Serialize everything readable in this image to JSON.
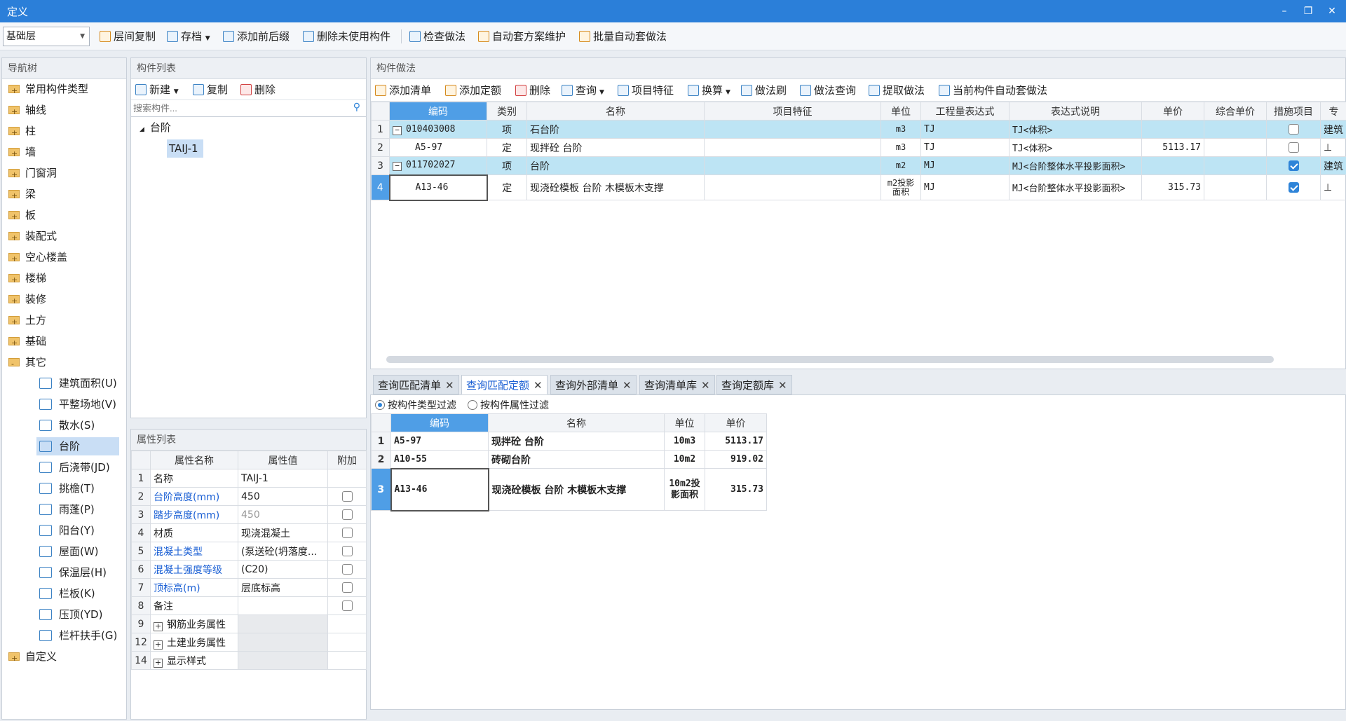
{
  "window": {
    "title": "定义",
    "minimize": "–",
    "restore": "❐",
    "close": "✕"
  },
  "toolbar": {
    "floor_select": "基础层",
    "items": [
      "层间复制",
      "存档",
      "添加前后缀",
      "删除未使用构件",
      "检查做法",
      "自动套方案维护",
      "批量自动套做法"
    ]
  },
  "nav": {
    "header": "导航树",
    "top_items": [
      "常用构件类型",
      "轴线",
      "柱",
      "墙",
      "门窗洞",
      "梁",
      "板",
      "装配式",
      "空心楼盖",
      "楼梯",
      "装修",
      "土方",
      "基础",
      "其它"
    ],
    "sub_items": [
      "建筑面积(U)",
      "平整场地(V)",
      "散水(S)",
      "台阶",
      "后浇带(JD)",
      "挑檐(T)",
      "雨蓬(P)",
      "阳台(Y)",
      "屋面(W)",
      "保温层(H)",
      "栏板(K)",
      "压顶(YD)",
      "栏杆扶手(G)"
    ],
    "last_item": "自定义"
  },
  "component_list": {
    "header": "构件列表",
    "new_label": "新建",
    "copy_label": "复制",
    "delete_label": "删除",
    "search_placeholder": "搜索构件...",
    "group": "台阶",
    "item": "TAIJ-1"
  },
  "properties": {
    "header": "属性列表",
    "columns": [
      "属性名称",
      "属性值",
      "附加"
    ],
    "rows": [
      {
        "n": "1",
        "name": "名称",
        "value": "TAIJ-1"
      },
      {
        "n": "2",
        "name": "台阶高度(mm)",
        "value": "450"
      },
      {
        "n": "3",
        "name": "踏步高度(mm)",
        "value": "450"
      },
      {
        "n": "4",
        "name": "材质",
        "value": "现浇混凝土"
      },
      {
        "n": "5",
        "name": "混凝土类型",
        "value": "(泵送砼(坍落度..."
      },
      {
        "n": "6",
        "name": "混凝土强度等级",
        "value": "(C20)"
      },
      {
        "n": "7",
        "name": "顶标高(m)",
        "value": "层底标高"
      },
      {
        "n": "8",
        "name": "备注",
        "value": ""
      },
      {
        "n": "9",
        "name": "钢筋业务属性",
        "value": ""
      },
      {
        "n": "12",
        "name": "土建业务属性",
        "value": ""
      },
      {
        "n": "14",
        "name": "显示样式",
        "value": ""
      }
    ]
  },
  "method": {
    "header": "构件做法",
    "toolbar": [
      "添加清单",
      "添加定额",
      "删除",
      "查询",
      "项目特征",
      "换算",
      "做法刷",
      "做法查询",
      "提取做法",
      "当前构件自动套做法"
    ],
    "columns": [
      "编码",
      "类别",
      "名称",
      "项目特征",
      "单位",
      "工程量表达式",
      "表达式说明",
      "单价",
      "综合单价",
      "措施项目",
      "专"
    ],
    "rows": [
      {
        "n": "1",
        "code": "010403008",
        "type": "项",
        "name": "石台阶",
        "feature": "",
        "unit": "m3",
        "expr": "TJ",
        "desc": "TJ<体积>",
        "price": "",
        "total": "",
        "check": false,
        "extra": "建筑"
      },
      {
        "n": "2",
        "code": "A5-97",
        "type": "定",
        "name": "现拌砼 台阶",
        "feature": "",
        "unit": "m3",
        "expr": "TJ",
        "desc": "TJ<体积>",
        "price": "5113.17",
        "total": "",
        "check": false,
        "extra": "⊥"
      },
      {
        "n": "3",
        "code": "011702027",
        "type": "项",
        "name": "台阶",
        "feature": "",
        "unit": "m2",
        "expr": "MJ",
        "desc": "MJ<台阶整体水平投影面积>",
        "price": "",
        "total": "",
        "check": true,
        "extra": "建筑"
      },
      {
        "n": "4",
        "code": "A13-46",
        "type": "定",
        "name": "现浇砼模板 台阶 木模板木支撑",
        "feature": "",
        "unit": "m2投影面积",
        "expr": "MJ",
        "desc": "MJ<台阶整体水平投影面积>",
        "price": "315.73",
        "total": "",
        "check": true,
        "extra": "⊥"
      }
    ]
  },
  "query": {
    "tabs": [
      "查询匹配清单",
      "查询匹配定额",
      "查询外部清单",
      "查询清单库",
      "查询定额库"
    ],
    "filters": [
      "按构件类型过滤",
      "按构件属性过滤"
    ],
    "columns": [
      "编码",
      "名称",
      "单位",
      "单价"
    ],
    "rows": [
      {
        "n": "1",
        "code": "A5-97",
        "name": "现拌砼 台阶",
        "unit": "10m3",
        "price": "5113.17"
      },
      {
        "n": "2",
        "code": "A10-55",
        "name": "砖砌台阶",
        "unit": "10m2",
        "price": "919.02"
      },
      {
        "n": "3",
        "code": "A13-46",
        "name": "现浇砼模板 台阶 木模板木支撑",
        "unit": "10m2投影面积",
        "price": "315.73"
      }
    ]
  }
}
